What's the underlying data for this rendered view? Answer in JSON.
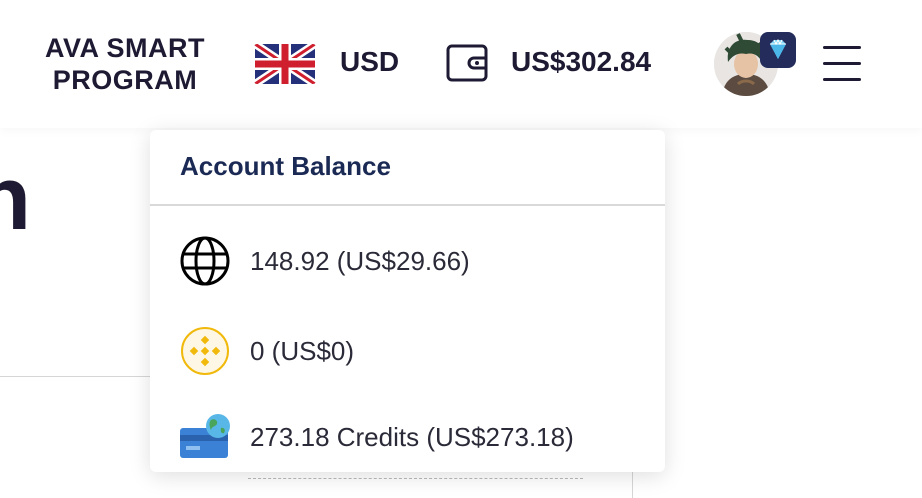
{
  "header": {
    "brand": "AVA SMART\nPROGRAM",
    "language_flag": "uk-flag-icon",
    "currency": "USD",
    "wallet_icon": "wallet-icon",
    "wallet_balance": "US$302.84",
    "avatar_icon": "user-avatar",
    "avatar_badge_icon": "diamond-icon",
    "menu_icon": "hamburger-menu-icon"
  },
  "account_balance": {
    "title": "Account Balance",
    "items": [
      {
        "icon": "globe-icon",
        "label": "148.92 (US$29.66)"
      },
      {
        "icon": "binance-coin-icon",
        "label": "0 (US$0)"
      },
      {
        "icon": "credits-card-globe-icon",
        "label": "273.18 Credits (US$273.18)"
      }
    ]
  },
  "colors": {
    "text_dark": "#1e1a33",
    "title_navy": "#1b2a54",
    "binance_gold": "#f0b90b",
    "credits_blue": "#3b82d6",
    "badge_bg": "#232c5a"
  }
}
